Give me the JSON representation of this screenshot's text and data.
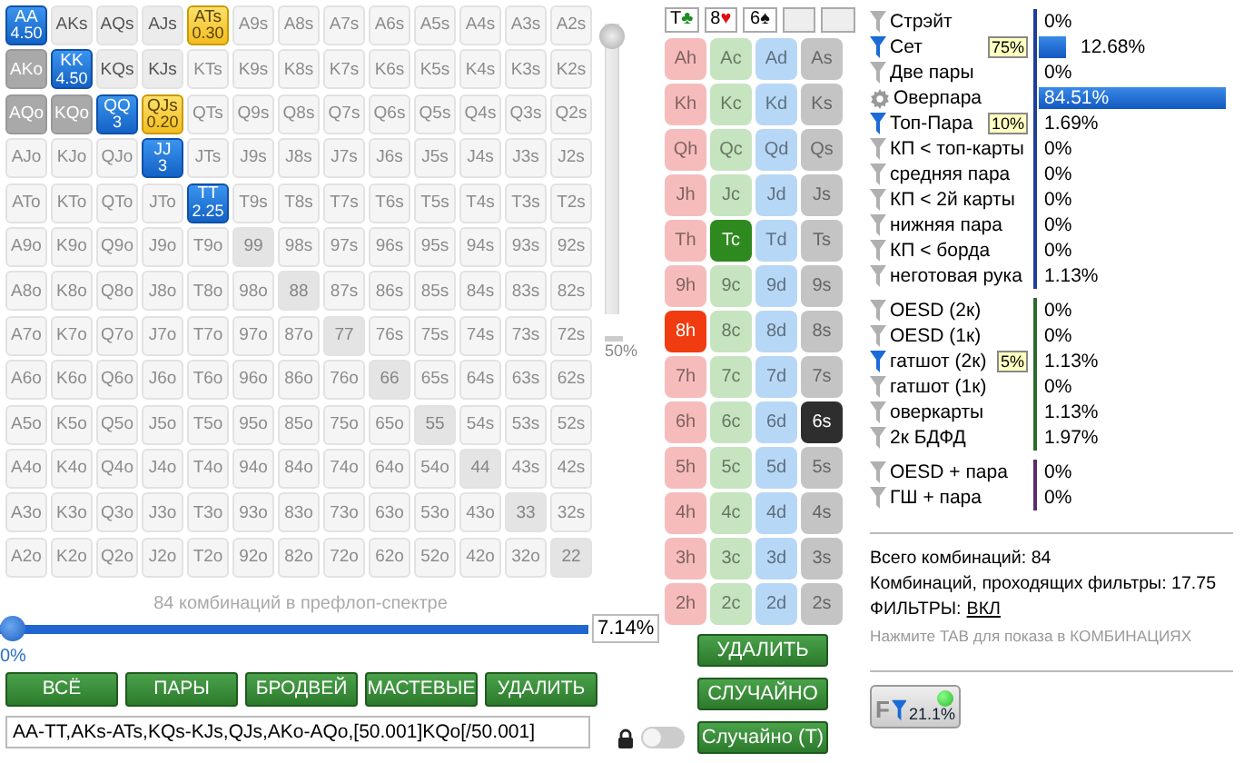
{
  "range_grid": {
    "rows": [
      [
        {
          "label": "AA",
          "kind": "blue",
          "weight": "4.50"
        },
        {
          "label": "AKs",
          "kind": "light"
        },
        {
          "label": "AQs",
          "kind": "light"
        },
        {
          "label": "AJs",
          "kind": "light"
        },
        {
          "label": "ATs",
          "kind": "yellow",
          "weight": "0.30"
        },
        {
          "label": "A9s",
          "kind": "none"
        },
        {
          "label": "A8s",
          "kind": "none"
        },
        {
          "label": "A7s",
          "kind": "none"
        },
        {
          "label": "A6s",
          "kind": "none"
        },
        {
          "label": "A5s",
          "kind": "none"
        },
        {
          "label": "A4s",
          "kind": "none"
        },
        {
          "label": "A3s",
          "kind": "none"
        },
        {
          "label": "A2s",
          "kind": "none"
        }
      ],
      [
        {
          "label": "AKo",
          "kind": "range"
        },
        {
          "label": "KK",
          "kind": "blue",
          "weight": "4.50"
        },
        {
          "label": "KQs",
          "kind": "light"
        },
        {
          "label": "KJs",
          "kind": "light"
        },
        {
          "label": "KTs",
          "kind": "none"
        },
        {
          "label": "K9s",
          "kind": "none"
        },
        {
          "label": "K8s",
          "kind": "none"
        },
        {
          "label": "K7s",
          "kind": "none"
        },
        {
          "label": "K6s",
          "kind": "none"
        },
        {
          "label": "K5s",
          "kind": "none"
        },
        {
          "label": "K4s",
          "kind": "none"
        },
        {
          "label": "K3s",
          "kind": "none"
        },
        {
          "label": "K2s",
          "kind": "none"
        }
      ],
      [
        {
          "label": "AQo",
          "kind": "range"
        },
        {
          "label": "KQo",
          "kind": "range"
        },
        {
          "label": "QQ",
          "kind": "blue",
          "weight": "3"
        },
        {
          "label": "QJs",
          "kind": "yellow",
          "weight": "0.20"
        },
        {
          "label": "QTs",
          "kind": "none"
        },
        {
          "label": "Q9s",
          "kind": "none"
        },
        {
          "label": "Q8s",
          "kind": "none"
        },
        {
          "label": "Q7s",
          "kind": "none"
        },
        {
          "label": "Q6s",
          "kind": "none"
        },
        {
          "label": "Q5s",
          "kind": "none"
        },
        {
          "label": "Q4s",
          "kind": "none"
        },
        {
          "label": "Q3s",
          "kind": "none"
        },
        {
          "label": "Q2s",
          "kind": "none"
        }
      ],
      [
        {
          "label": "AJo",
          "kind": "none"
        },
        {
          "label": "KJo",
          "kind": "none"
        },
        {
          "label": "QJo",
          "kind": "none"
        },
        {
          "label": "JJ",
          "kind": "blue",
          "weight": "3"
        },
        {
          "label": "JTs",
          "kind": "none"
        },
        {
          "label": "J9s",
          "kind": "none"
        },
        {
          "label": "J8s",
          "kind": "none"
        },
        {
          "label": "J7s",
          "kind": "none"
        },
        {
          "label": "J6s",
          "kind": "none"
        },
        {
          "label": "J5s",
          "kind": "none"
        },
        {
          "label": "J4s",
          "kind": "none"
        },
        {
          "label": "J3s",
          "kind": "none"
        },
        {
          "label": "J2s",
          "kind": "none"
        }
      ],
      [
        {
          "label": "ATo",
          "kind": "none"
        },
        {
          "label": "KTo",
          "kind": "none"
        },
        {
          "label": "QTo",
          "kind": "none"
        },
        {
          "label": "JTo",
          "kind": "none"
        },
        {
          "label": "TT",
          "kind": "blue",
          "weight": "2.25"
        },
        {
          "label": "T9s",
          "kind": "none"
        },
        {
          "label": "T8s",
          "kind": "none"
        },
        {
          "label": "T7s",
          "kind": "none"
        },
        {
          "label": "T6s",
          "kind": "none"
        },
        {
          "label": "T5s",
          "kind": "none"
        },
        {
          "label": "T4s",
          "kind": "none"
        },
        {
          "label": "T3s",
          "kind": "none"
        },
        {
          "label": "T2s",
          "kind": "none"
        }
      ],
      [
        {
          "label": "A9o",
          "kind": "none"
        },
        {
          "label": "K9o",
          "kind": "none"
        },
        {
          "label": "Q9o",
          "kind": "none"
        },
        {
          "label": "J9o",
          "kind": "none"
        },
        {
          "label": "T9o",
          "kind": "none"
        },
        {
          "label": "99",
          "kind": "pair"
        },
        {
          "label": "98s",
          "kind": "none"
        },
        {
          "label": "97s",
          "kind": "none"
        },
        {
          "label": "96s",
          "kind": "none"
        },
        {
          "label": "95s",
          "kind": "none"
        },
        {
          "label": "94s",
          "kind": "none"
        },
        {
          "label": "93s",
          "kind": "none"
        },
        {
          "label": "92s",
          "kind": "none"
        }
      ],
      [
        {
          "label": "A8o",
          "kind": "none"
        },
        {
          "label": "K8o",
          "kind": "none"
        },
        {
          "label": "Q8o",
          "kind": "none"
        },
        {
          "label": "J8o",
          "kind": "none"
        },
        {
          "label": "T8o",
          "kind": "none"
        },
        {
          "label": "98o",
          "kind": "none"
        },
        {
          "label": "88",
          "kind": "pair"
        },
        {
          "label": "87s",
          "kind": "none"
        },
        {
          "label": "86s",
          "kind": "none"
        },
        {
          "label": "85s",
          "kind": "none"
        },
        {
          "label": "84s",
          "kind": "none"
        },
        {
          "label": "83s",
          "kind": "none"
        },
        {
          "label": "82s",
          "kind": "none"
        }
      ],
      [
        {
          "label": "A7o",
          "kind": "none"
        },
        {
          "label": "K7o",
          "kind": "none"
        },
        {
          "label": "Q7o",
          "kind": "none"
        },
        {
          "label": "J7o",
          "kind": "none"
        },
        {
          "label": "T7o",
          "kind": "none"
        },
        {
          "label": "97o",
          "kind": "none"
        },
        {
          "label": "87o",
          "kind": "none"
        },
        {
          "label": "77",
          "kind": "pair"
        },
        {
          "label": "76s",
          "kind": "none"
        },
        {
          "label": "75s",
          "kind": "none"
        },
        {
          "label": "74s",
          "kind": "none"
        },
        {
          "label": "73s",
          "kind": "none"
        },
        {
          "label": "72s",
          "kind": "none"
        }
      ],
      [
        {
          "label": "A6o",
          "kind": "none"
        },
        {
          "label": "K6o",
          "kind": "none"
        },
        {
          "label": "Q6o",
          "kind": "none"
        },
        {
          "label": "J6o",
          "kind": "none"
        },
        {
          "label": "T6o",
          "kind": "none"
        },
        {
          "label": "96o",
          "kind": "none"
        },
        {
          "label": "86o",
          "kind": "none"
        },
        {
          "label": "76o",
          "kind": "none"
        },
        {
          "label": "66",
          "kind": "pair"
        },
        {
          "label": "65s",
          "kind": "none"
        },
        {
          "label": "64s",
          "kind": "none"
        },
        {
          "label": "63s",
          "kind": "none"
        },
        {
          "label": "62s",
          "kind": "none"
        }
      ],
      [
        {
          "label": "A5o",
          "kind": "none"
        },
        {
          "label": "K5o",
          "kind": "none"
        },
        {
          "label": "Q5o",
          "kind": "none"
        },
        {
          "label": "J5o",
          "kind": "none"
        },
        {
          "label": "T5o",
          "kind": "none"
        },
        {
          "label": "95o",
          "kind": "none"
        },
        {
          "label": "85o",
          "kind": "none"
        },
        {
          "label": "75o",
          "kind": "none"
        },
        {
          "label": "65o",
          "kind": "none"
        },
        {
          "label": "55",
          "kind": "pair"
        },
        {
          "label": "54s",
          "kind": "none"
        },
        {
          "label": "53s",
          "kind": "none"
        },
        {
          "label": "52s",
          "kind": "none"
        }
      ],
      [
        {
          "label": "A4o",
          "kind": "none"
        },
        {
          "label": "K4o",
          "kind": "none"
        },
        {
          "label": "Q4o",
          "kind": "none"
        },
        {
          "label": "J4o",
          "kind": "none"
        },
        {
          "label": "T4o",
          "kind": "none"
        },
        {
          "label": "94o",
          "kind": "none"
        },
        {
          "label": "84o",
          "kind": "none"
        },
        {
          "label": "74o",
          "kind": "none"
        },
        {
          "label": "64o",
          "kind": "none"
        },
        {
          "label": "54o",
          "kind": "none"
        },
        {
          "label": "44",
          "kind": "pair"
        },
        {
          "label": "43s",
          "kind": "none"
        },
        {
          "label": "42s",
          "kind": "none"
        }
      ],
      [
        {
          "label": "A3o",
          "kind": "none"
        },
        {
          "label": "K3o",
          "kind": "none"
        },
        {
          "label": "Q3o",
          "kind": "none"
        },
        {
          "label": "J3o",
          "kind": "none"
        },
        {
          "label": "T3o",
          "kind": "none"
        },
        {
          "label": "93o",
          "kind": "none"
        },
        {
          "label": "83o",
          "kind": "none"
        },
        {
          "label": "73o",
          "kind": "none"
        },
        {
          "label": "63o",
          "kind": "none"
        },
        {
          "label": "53o",
          "kind": "none"
        },
        {
          "label": "43o",
          "kind": "none"
        },
        {
          "label": "33",
          "kind": "pair"
        },
        {
          "label": "32s",
          "kind": "none"
        }
      ],
      [
        {
          "label": "A2o",
          "kind": "none"
        },
        {
          "label": "K2o",
          "kind": "none"
        },
        {
          "label": "Q2o",
          "kind": "none"
        },
        {
          "label": "J2o",
          "kind": "none"
        },
        {
          "label": "T2o",
          "kind": "none"
        },
        {
          "label": "92o",
          "kind": "none"
        },
        {
          "label": "82o",
          "kind": "none"
        },
        {
          "label": "72o",
          "kind": "none"
        },
        {
          "label": "62o",
          "kind": "none"
        },
        {
          "label": "52o",
          "kind": "none"
        },
        {
          "label": "42o",
          "kind": "none"
        },
        {
          "label": "32o",
          "kind": "none"
        },
        {
          "label": "22",
          "kind": "pair"
        }
      ]
    ]
  },
  "weight_slider": {
    "level": 1,
    "label": "50%"
  },
  "range_caption": "84 комбинаций в префлоп-спектре",
  "range_slider": {
    "level": 0,
    "min_label": "0%",
    "value": "7.14%"
  },
  "range_buttons": [
    "ВСЁ",
    "ПАРЫ",
    "БРОДВЕЙ",
    "МАСТЕВЫЕ",
    "УДАЛИТЬ"
  ],
  "range_text": "AA-TT,AKs-ATs,KQs-KJs,QJs,AKo-AQo,[50.001]KQo[/50.001]",
  "board": [
    {
      "filled": true,
      "rank": "T",
      "suit": "♣",
      "color": "#1f8a1f"
    },
    {
      "filled": true,
      "rank": "8",
      "suit": "♥",
      "color": "#e01010"
    },
    {
      "filled": true,
      "rank": "6",
      "suit": "♠",
      "color": "#111111"
    },
    {
      "filled": false
    },
    {
      "filled": false
    }
  ],
  "deck": [
    {
      "color": "#f6bcbc",
      "cards": [
        {
          "label": "Ah",
          "board": false
        },
        {
          "label": "Kh",
          "board": false
        },
        {
          "label": "Qh",
          "board": false
        },
        {
          "label": "Jh",
          "board": false
        },
        {
          "label": "Th",
          "board": false
        },
        {
          "label": "9h",
          "board": false
        },
        {
          "label": "8h",
          "board": true,
          "color": "#f03c10"
        },
        {
          "label": "7h",
          "board": false
        },
        {
          "label": "6h",
          "board": false
        },
        {
          "label": "5h",
          "board": false
        },
        {
          "label": "4h",
          "board": false
        },
        {
          "label": "3h",
          "board": false
        },
        {
          "label": "2h",
          "board": false
        }
      ]
    },
    {
      "color": "#c6e4bf",
      "cards": [
        {
          "label": "Ac",
          "board": false
        },
        {
          "label": "Kc",
          "board": false
        },
        {
          "label": "Qc",
          "board": false
        },
        {
          "label": "Jc",
          "board": false
        },
        {
          "label": "Tc",
          "board": true,
          "color": "#2e8a1e"
        },
        {
          "label": "9c",
          "board": false
        },
        {
          "label": "8c",
          "board": false
        },
        {
          "label": "7c",
          "board": false
        },
        {
          "label": "6c",
          "board": false
        },
        {
          "label": "5c",
          "board": false
        },
        {
          "label": "4c",
          "board": false
        },
        {
          "label": "3c",
          "board": false
        },
        {
          "label": "2c",
          "board": false
        }
      ]
    },
    {
      "color": "#b7d7f6",
      "cards": [
        {
          "label": "Ad",
          "board": false
        },
        {
          "label": "Kd",
          "board": false
        },
        {
          "label": "Qd",
          "board": false
        },
        {
          "label": "Jd",
          "board": false
        },
        {
          "label": "Td",
          "board": false
        },
        {
          "label": "9d",
          "board": false
        },
        {
          "label": "8d",
          "board": false
        },
        {
          "label": "7d",
          "board": false
        },
        {
          "label": "6d",
          "board": false
        },
        {
          "label": "5d",
          "board": false
        },
        {
          "label": "4d",
          "board": false
        },
        {
          "label": "3d",
          "board": false
        },
        {
          "label": "2d",
          "board": false
        }
      ]
    },
    {
      "color": "#c4c4c4",
      "cards": [
        {
          "label": "As",
          "board": false
        },
        {
          "label": "Ks",
          "board": false
        },
        {
          "label": "Qs",
          "board": false
        },
        {
          "label": "Js",
          "board": false
        },
        {
          "label": "Ts",
          "board": false
        },
        {
          "label": "9s",
          "board": false
        },
        {
          "label": "8s",
          "board": false
        },
        {
          "label": "7s",
          "board": false
        },
        {
          "label": "6s",
          "board": true,
          "color": "#2e2e2e"
        },
        {
          "label": "5s",
          "board": false
        },
        {
          "label": "4s",
          "board": false
        },
        {
          "label": "3s",
          "board": false
        },
        {
          "label": "2s",
          "board": false
        }
      ]
    }
  ],
  "deck_buttons": [
    "УДАЛИТЬ",
    "СЛУЧАЙНО"
  ],
  "lock_toggle": {
    "on": false
  },
  "random_turn_button": "Случайно (Т)",
  "filter_groups": [
    {
      "color": "#1d3f96",
      "rows": [
        {
          "kind": "filter",
          "active": false,
          "label": "Стрэйт",
          "value": "0%"
        },
        {
          "kind": "filter",
          "active": true,
          "label": "Сет",
          "badge": "75%",
          "value": "12.68%",
          "level": 0.1268
        },
        {
          "kind": "filter",
          "active": false,
          "label": "Две пары",
          "value": "0%"
        },
        {
          "kind": "settings",
          "active": false,
          "label": "Оверпара",
          "value": "84.51%",
          "level": 0.8451
        },
        {
          "kind": "filter",
          "active": true,
          "label": "Топ-Пара",
          "badge": "10%",
          "value": "1.69%"
        },
        {
          "kind": "filter",
          "active": false,
          "label": "КП < топ-карты",
          "value": "0%"
        },
        {
          "kind": "filter",
          "active": false,
          "label": "средняя пара",
          "value": "0%"
        },
        {
          "kind": "filter",
          "active": false,
          "label": "КП < 2й карты",
          "value": "0%"
        },
        {
          "kind": "filter",
          "active": false,
          "label": "нижняя пара",
          "value": "0%"
        },
        {
          "kind": "filter",
          "active": false,
          "label": "КП < борда",
          "value": "0%"
        },
        {
          "kind": "filter",
          "active": false,
          "label": "неготовая рука",
          "value": "1.13%"
        }
      ]
    },
    {
      "color": "#2d6a2d",
      "rows": [
        {
          "kind": "filter",
          "active": false,
          "label": "OESD (2к)",
          "value": "0%"
        },
        {
          "kind": "filter",
          "active": false,
          "label": "OESD (1к)",
          "value": "0%"
        },
        {
          "kind": "filter",
          "active": true,
          "label": "гатшот (2к)",
          "badge": "5%",
          "value": "1.13%"
        },
        {
          "kind": "filter",
          "active": false,
          "label": "гатшот (1к)",
          "value": "0%"
        },
        {
          "kind": "filter",
          "active": false,
          "label": "оверкарты",
          "value": "1.13%"
        },
        {
          "kind": "filter",
          "active": false,
          "label": "2к БДФД",
          "value": "1.97%"
        }
      ]
    },
    {
      "color": "#5a2d6e",
      "rows": [
        {
          "kind": "filter",
          "active": false,
          "label": "OESD + пара",
          "value": "0%"
        },
        {
          "kind": "filter",
          "active": false,
          "label": "ГШ + пара",
          "value": "0%"
        }
      ]
    }
  ],
  "summary": {
    "total": "Всего комбинаций: 84",
    "passing": "Комбинаций, проходящих фильтры: 17.75",
    "filters_label": "ФИЛЬТРЫ:",
    "filters_link": "ВКЛ",
    "hint": "Нажмите TAB для показа в КОМБИНАЦИЯХ"
  },
  "filter_button": {
    "letter": "F",
    "value": "21.1%",
    "status_on": true
  }
}
